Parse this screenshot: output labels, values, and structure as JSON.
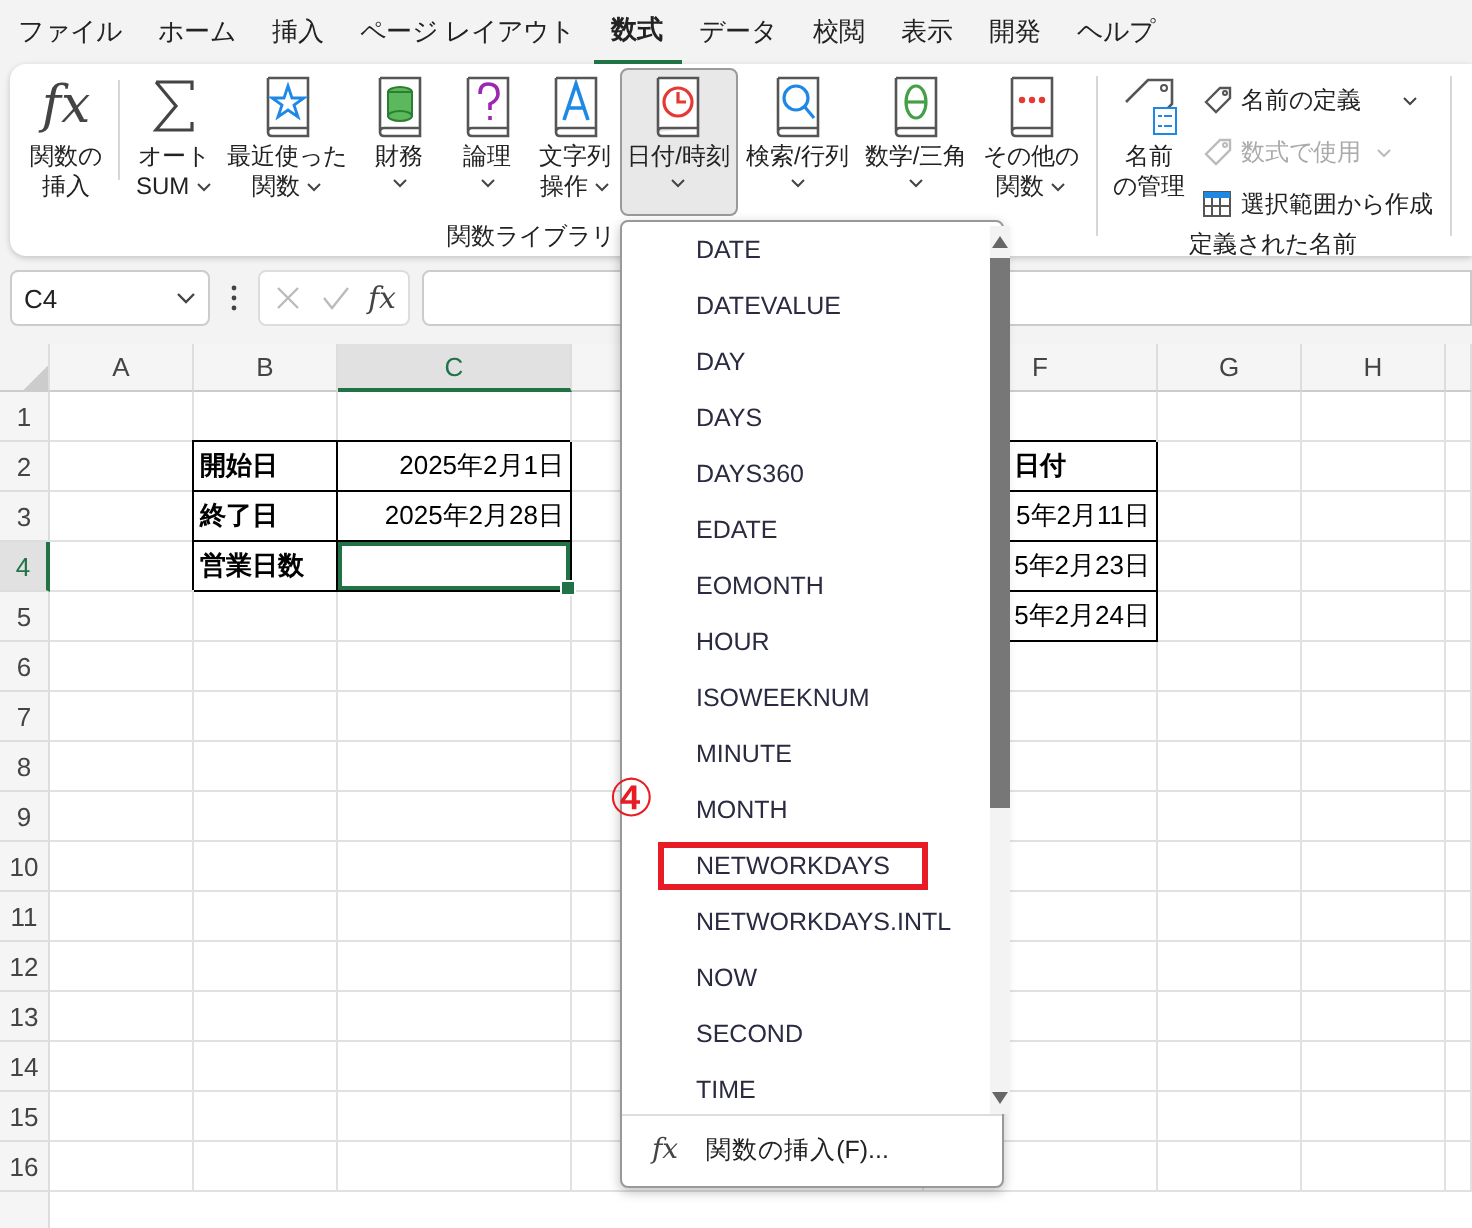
{
  "menu_tabs": [
    {
      "label": "ファイル",
      "selected": false
    },
    {
      "label": "ホーム",
      "selected": false
    },
    {
      "label": "挿入",
      "selected": false
    },
    {
      "label": "ページ レイアウト",
      "selected": false
    },
    {
      "label": "数式",
      "selected": true
    },
    {
      "label": "データ",
      "selected": false
    },
    {
      "label": "校閲",
      "selected": false
    },
    {
      "label": "表示",
      "selected": false
    },
    {
      "label": "開発",
      "selected": false
    },
    {
      "label": "ヘルプ",
      "selected": false
    }
  ],
  "ribbon": {
    "library": {
      "label": "関数ライブラリ",
      "buttons": [
        {
          "kind": "insert_function",
          "glyph": "fx",
          "lines": [
            "関数の",
            "挿入"
          ],
          "dropdown": false,
          "selected": false
        },
        {
          "kind": "autosum",
          "lines": [
            "オート",
            "SUM"
          ],
          "dropdown": true,
          "selected": false
        },
        {
          "kind": "recent",
          "lines": [
            "最近使った",
            "関数"
          ],
          "dropdown": true,
          "selected": false
        },
        {
          "kind": "financial",
          "lines": [
            "財務"
          ],
          "dropdown": true,
          "selected": false
        },
        {
          "kind": "logical",
          "lines": [
            "論理"
          ],
          "dropdown": true,
          "selected": false
        },
        {
          "kind": "text",
          "lines": [
            "文字列",
            "操作"
          ],
          "dropdown": true,
          "selected": false
        },
        {
          "kind": "datetime",
          "lines": [
            "日付/時刻"
          ],
          "dropdown": true,
          "selected": true
        },
        {
          "kind": "lookup",
          "lines": [
            "検索/行列"
          ],
          "dropdown": true,
          "selected": false
        },
        {
          "kind": "math",
          "lines": [
            "数学/三角"
          ],
          "dropdown": true,
          "selected": false
        },
        {
          "kind": "more",
          "lines": [
            "その他の",
            "関数"
          ],
          "dropdown": true,
          "selected": false
        }
      ]
    },
    "names": {
      "label": "定義された名前",
      "manager": {
        "lines": [
          "名前",
          "の管理"
        ]
      },
      "small_buttons": [
        {
          "kind": "define",
          "label": "名前の定義",
          "dropdown": true,
          "disabled": false
        },
        {
          "kind": "use",
          "label": "数式で使用",
          "dropdown": true,
          "disabled": true
        },
        {
          "kind": "create",
          "label": "選択範囲から作成",
          "dropdown": false,
          "disabled": false
        }
      ]
    }
  },
  "formula_bar": {
    "name_box": "C4",
    "function_glyph": "fx"
  },
  "sheet": {
    "columns": [
      {
        "label": "A",
        "selected": false
      },
      {
        "label": "B",
        "selected": false
      },
      {
        "label": "C",
        "selected": true
      },
      {
        "label": "F",
        "selected": false
      },
      {
        "label": "G",
        "selected": false
      },
      {
        "label": "H",
        "selected": false
      }
    ],
    "rows": [
      {
        "label": "1",
        "selected": false
      },
      {
        "label": "2",
        "selected": false
      },
      {
        "label": "3",
        "selected": false
      },
      {
        "label": "4",
        "selected": true
      },
      {
        "label": "5",
        "selected": false
      },
      {
        "label": "6",
        "selected": false
      },
      {
        "label": "7",
        "selected": false
      },
      {
        "label": "8",
        "selected": false
      },
      {
        "label": "9",
        "selected": false
      },
      {
        "label": "10",
        "selected": false
      },
      {
        "label": "11",
        "selected": false
      },
      {
        "label": "12",
        "selected": false
      },
      {
        "label": "13",
        "selected": false
      },
      {
        "label": "14",
        "selected": false
      },
      {
        "label": "15",
        "selected": false
      },
      {
        "label": "16",
        "selected": false
      }
    ],
    "label_table": [
      {
        "label": "開始日",
        "value": "2025年2月1日"
      },
      {
        "label": "終了日",
        "value": "2025年2月28日"
      },
      {
        "label": "営業日数"
      }
    ],
    "date_list": {
      "header": "日付",
      "values": [
        "5年2月11日",
        "5年2月23日",
        "5年2月24日"
      ]
    }
  },
  "dropdown": {
    "items": [
      {
        "label": "DATE",
        "highlighted": false
      },
      {
        "label": "DATEVALUE",
        "highlighted": false
      },
      {
        "label": "DAY",
        "highlighted": false
      },
      {
        "label": "DAYS",
        "highlighted": false
      },
      {
        "label": "DAYS360",
        "highlighted": false
      },
      {
        "label": "EDATE",
        "highlighted": false
      },
      {
        "label": "EOMONTH",
        "highlighted": false
      },
      {
        "label": "HOUR",
        "highlighted": false
      },
      {
        "label": "ISOWEEKNUM",
        "highlighted": false
      },
      {
        "label": "MINUTE",
        "highlighted": false
      },
      {
        "label": "MONTH",
        "highlighted": false
      },
      {
        "label": "NETWORKDAYS",
        "highlighted": true
      },
      {
        "label": "NETWORKDAYS.INTL",
        "highlighted": false
      },
      {
        "label": "NOW",
        "highlighted": false
      },
      {
        "label": "SECOND",
        "highlighted": false
      },
      {
        "label": "TIME",
        "highlighted": false
      }
    ],
    "footer": {
      "glyph": "fx",
      "label": "関数の挿入(F)..."
    }
  },
  "callout": "④"
}
